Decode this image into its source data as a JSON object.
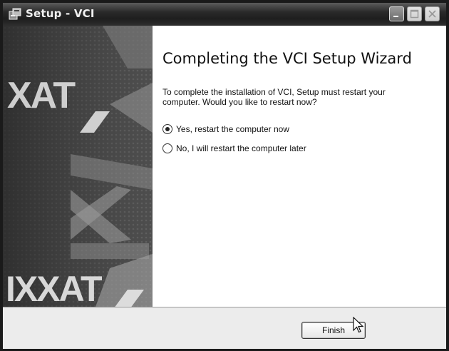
{
  "window": {
    "title": "Setup - VCI",
    "controls": [
      "minimize-icon",
      "maximize-icon",
      "close-icon"
    ]
  },
  "sidebar": {
    "brand_top": "XAT",
    "brand_bottom": "IXXAT"
  },
  "content": {
    "heading": "Completing the VCI Setup Wizard",
    "message": "To complete the installation of VCI, Setup must restart your computer. Would you like to restart now?",
    "options": [
      {
        "label": "Yes, restart the computer now",
        "selected": true
      },
      {
        "label": "No, I will restart the computer later",
        "selected": false
      }
    ]
  },
  "footer": {
    "finish_label": "Finish"
  }
}
